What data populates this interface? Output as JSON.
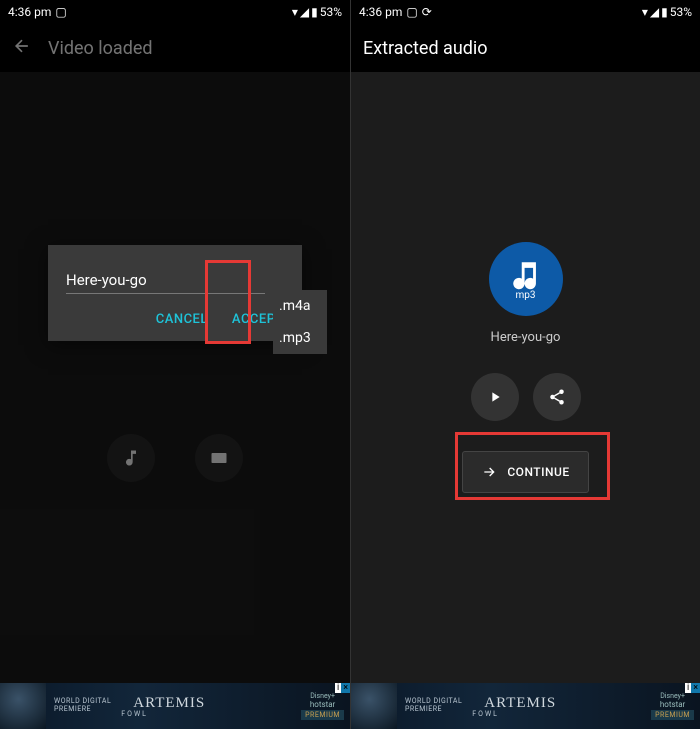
{
  "status": {
    "time": "4:36 pm",
    "battery": "53%"
  },
  "left": {
    "title": "Video loaded",
    "filename": "Here-you-go",
    "formats": [
      ".m4a",
      ".mp3"
    ],
    "cancel": "CANCEL",
    "accept": "ACCEPT"
  },
  "right": {
    "title": "Extracted audio",
    "format": "mp3",
    "filename": "Here-you-go",
    "continue": "CONTINUE"
  },
  "ad": {
    "line1": "WORLD DIGITAL",
    "line2": "PREMIERE",
    "movie": "ARTEMIS",
    "sub": "FOWL",
    "brand_top": "Disney+",
    "brand": "hotstar",
    "tier": "PREMIUM",
    "info": "i",
    "close": "×"
  }
}
